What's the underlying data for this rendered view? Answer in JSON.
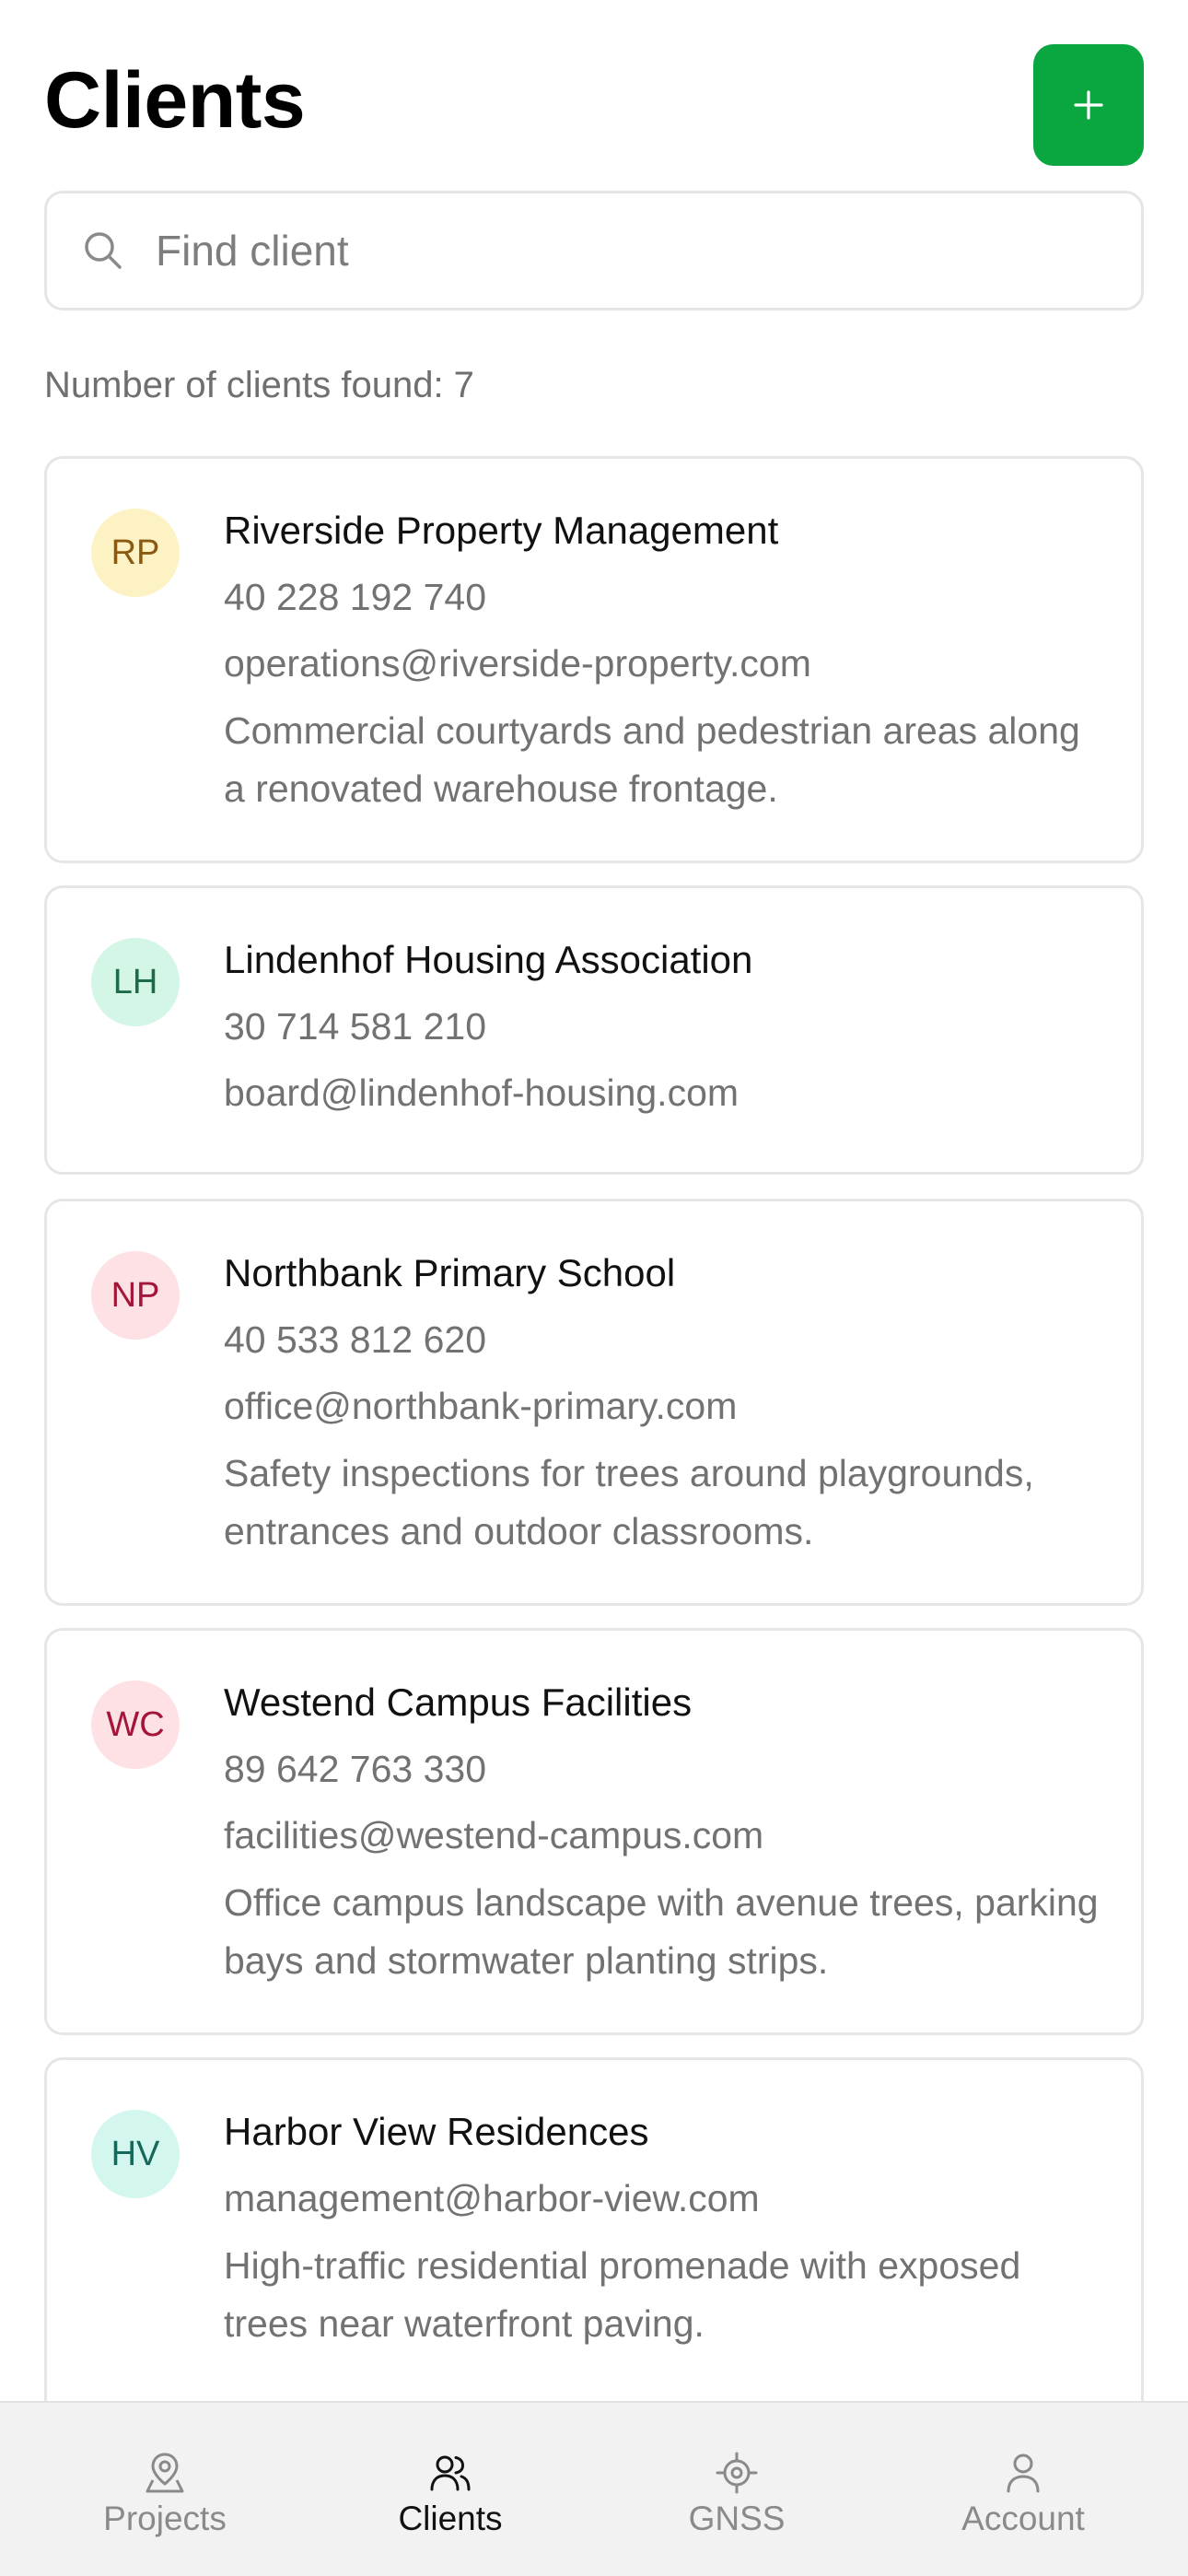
{
  "header": {
    "title": "Clients",
    "add_button_icon": "plus-icon"
  },
  "search": {
    "placeholder": "Find client",
    "value": "",
    "icon": "search-icon"
  },
  "results": {
    "count_label": "Number of clients found: 7"
  },
  "clients": [
    {
      "initials": "RP",
      "name": "Riverside Property Management",
      "phone": "40 228 192 740",
      "email": "operations@riverside-property.com",
      "description": "Commercial courtyards and pedestrian areas along a renovated warehouse frontage.",
      "avatar_bg": "#fdf2c4",
      "avatar_fg": "#8a5a12"
    },
    {
      "initials": "LH",
      "name": "Lindenhof Housing Association",
      "phone": "30 714 581 210",
      "email": "board@lindenhof-housing.com",
      "description": "",
      "avatar_bg": "#d3f6e6",
      "avatar_fg": "#1d6b4a"
    },
    {
      "initials": "NP",
      "name": "Northbank Primary School",
      "phone": "40 533 812 620",
      "email": "office@northbank-primary.com",
      "description": "Safety inspections for trees around playgrounds, entrances and outdoor classrooms.",
      "avatar_bg": "#fde1e4",
      "avatar_fg": "#a3163a"
    },
    {
      "initials": "WC",
      "name": "Westend Campus Facilities",
      "phone": "89 642 763 330",
      "email": "facilities@westend-campus.com",
      "description": "Office campus landscape with avenue trees, parking bays and stormwater planting strips.",
      "avatar_bg": "#fde1e4",
      "avatar_fg": "#a3163a"
    },
    {
      "initials": "HV",
      "name": "Harbor View Residences",
      "phone": "",
      "email": "management@harbor-view.com",
      "description": "High-traffic residential promenade with exposed trees near waterfront paving.",
      "avatar_bg": "#d3f6ee",
      "avatar_fg": "#16695a"
    }
  ],
  "tabbar": {
    "items": [
      {
        "label": "Projects",
        "icon": "map-pin-icon",
        "active": false
      },
      {
        "label": "Clients",
        "icon": "users-icon",
        "active": true
      },
      {
        "label": "GNSS",
        "icon": "crosshair-icon",
        "active": false
      },
      {
        "label": "Account",
        "icon": "user-icon",
        "active": false
      }
    ]
  },
  "colors": {
    "accent": "#0aa63f",
    "muted_text": "#727272",
    "border": "#e6e6e6",
    "tabbar_bg": "#f2f2f2"
  }
}
